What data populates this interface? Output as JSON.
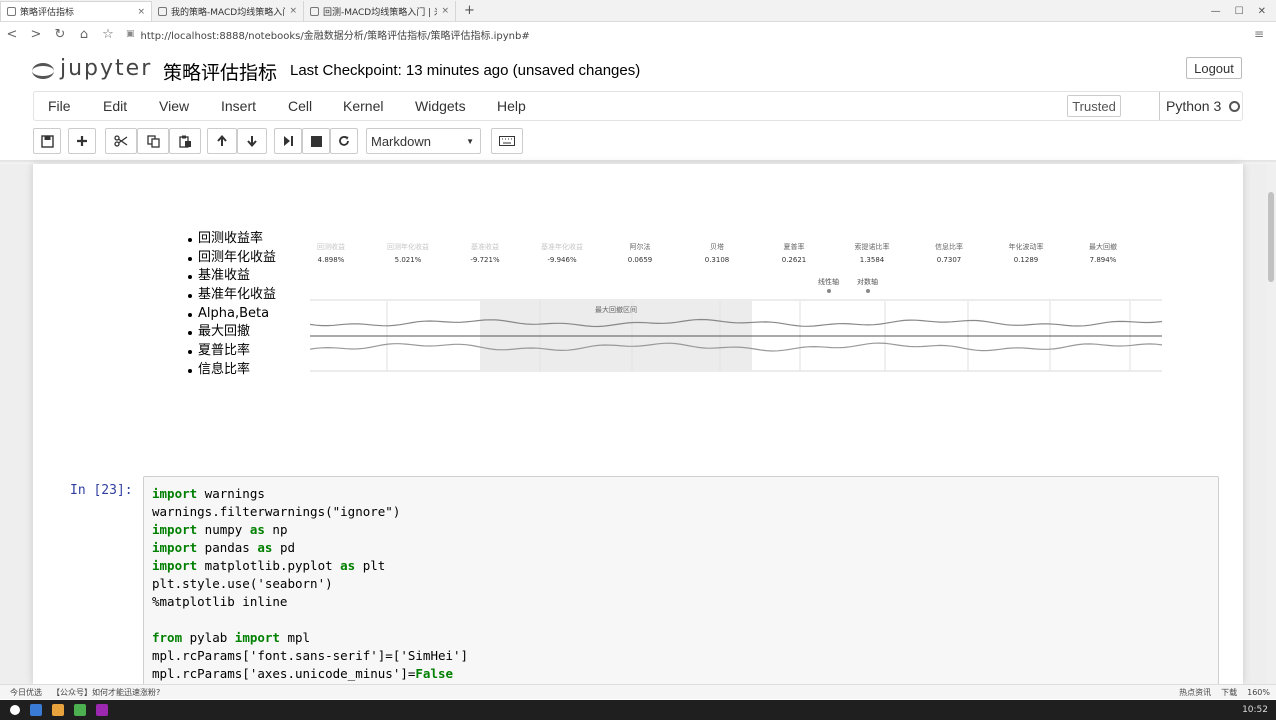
{
  "browser": {
    "tabs": [
      {
        "title": "策略评估指标",
        "active": true
      },
      {
        "title": "我的策略-MACD均线策略入门",
        "active": false
      },
      {
        "title": "回测-MACD均线策略入门 | 米筐",
        "active": false
      }
    ],
    "new_tab": "+",
    "url": "http://localhost:8888/notebooks/金融数据分析/策略评估指标/策略评估指标.ipynb#"
  },
  "jupyter": {
    "logo_text": "jupyter",
    "notebook_title": "策略评估指标",
    "checkpoint": "Last Checkpoint: 13 minutes ago (unsaved changes)",
    "logout_label": "Logout",
    "menu": [
      "File",
      "Edit",
      "View",
      "Insert",
      "Cell",
      "Kernel",
      "Widgets",
      "Help"
    ],
    "trusted_label": "Trusted",
    "kernel_name": "Python 3",
    "toolbar": {
      "icons": [
        "save-icon",
        "plus-icon",
        "cut-icon",
        "copy-icon",
        "paste-icon",
        "arrow-up-icon",
        "arrow-down-icon",
        "run-icon",
        "stop-icon",
        "restart-icon",
        "keyboard-icon"
      ],
      "cell_type": "Markdown"
    }
  },
  "markdown_cell": {
    "bullets": [
      "回测收益率",
      "回测年化收益",
      "基准收益",
      "基准年化收益",
      "Alpha,Beta",
      "最大回撤",
      "夏普比率",
      "信息比率"
    ],
    "metrics": [
      {
        "name": "回测收益",
        "value": "4.898%",
        "faded": true
      },
      {
        "name": "回测年化收益",
        "value": "5.021%",
        "faded": true
      },
      {
        "name": "基准收益",
        "value": "-9.721%",
        "faded": true
      },
      {
        "name": "基准年化收益",
        "value": "-9.946%",
        "faded": true
      },
      {
        "name": "阿尔法",
        "value": "0.0659",
        "faded": false
      },
      {
        "name": "贝塔",
        "value": "0.3108",
        "faded": false
      },
      {
        "name": "夏普率",
        "value": "0.2621",
        "faded": false
      },
      {
        "name": "索提诺比率",
        "value": "1.3584",
        "faded": false
      },
      {
        "name": "信息比率",
        "value": "0.7307",
        "faded": false
      },
      {
        "name": "年化波动率",
        "value": "0.1289",
        "faded": false
      },
      {
        "name": "最大回撤",
        "value": "7.894%",
        "faded": false
      }
    ],
    "legend": [
      "线性轴",
      "对数轴"
    ],
    "annotation": "最大回撤区间"
  },
  "code_cell": {
    "prompt": "In  [23]:",
    "lines": [
      [
        {
          "k": true,
          "t": "import"
        },
        {
          "k": false,
          "t": " warnings"
        }
      ],
      [
        {
          "k": false,
          "t": "warnings.filterwarnings(\"ignore\")"
        }
      ],
      [
        {
          "k": true,
          "t": "import"
        },
        {
          "k": false,
          "t": " numpy "
        },
        {
          "k": true,
          "t": "as"
        },
        {
          "k": false,
          "t": " np"
        }
      ],
      [
        {
          "k": true,
          "t": "import"
        },
        {
          "k": false,
          "t": " pandas "
        },
        {
          "k": true,
          "t": "as"
        },
        {
          "k": false,
          "t": " pd"
        }
      ],
      [
        {
          "k": true,
          "t": "import"
        },
        {
          "k": false,
          "t": " matplotlib.pyplot "
        },
        {
          "k": true,
          "t": "as"
        },
        {
          "k": false,
          "t": " plt"
        }
      ],
      [
        {
          "k": false,
          "t": "plt.style.use('seaborn')"
        }
      ],
      [
        {
          "k": false,
          "t": "%matplotlib inline"
        }
      ],
      [
        {
          "k": false,
          "t": ""
        }
      ],
      [
        {
          "k": true,
          "t": "from"
        },
        {
          "k": false,
          "t": " pylab "
        },
        {
          "k": true,
          "t": "import"
        },
        {
          "k": false,
          "t": " mpl"
        }
      ],
      [
        {
          "k": false,
          "t": "mpl.rcParams['font.sans-serif']=['SimHei']"
        }
      ],
      [
        {
          "k": false,
          "t": "mpl.rcParams['axes.unicode_minus']="
        },
        {
          "k": true,
          "t": "False"
        }
      ]
    ]
  },
  "status": {
    "left": [
      "今日优选",
      "【公众号】如何才能迅速涨粉?"
    ],
    "right": [
      "热点资讯",
      "下载",
      "160%"
    ]
  },
  "taskbar": {
    "time": "10:52"
  }
}
